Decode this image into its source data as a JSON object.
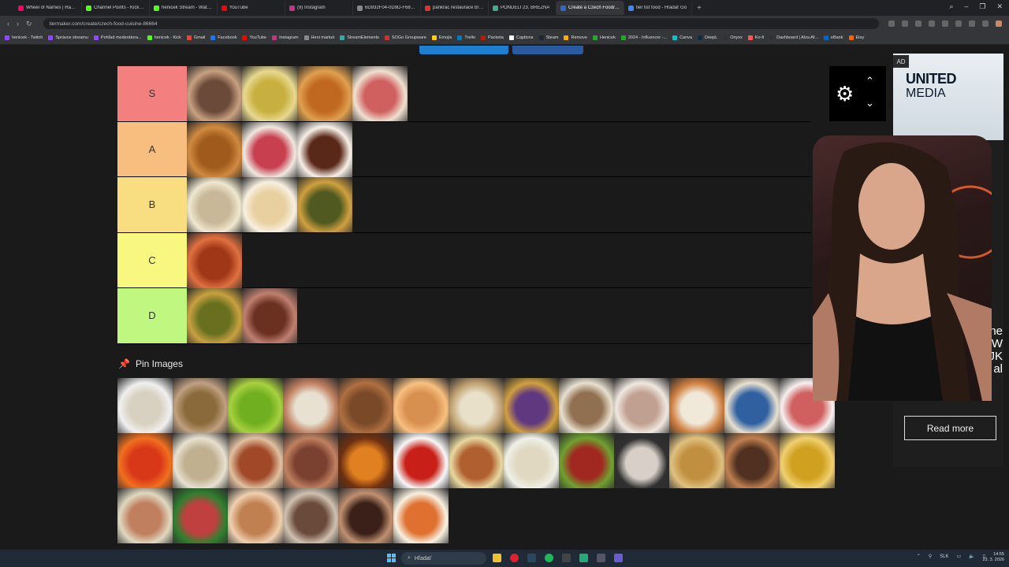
{
  "browser": {
    "tabs": [
      {
        "label": "Wheel of Names | Rando",
        "color": "#f06"
      },
      {
        "label": "Channel Points - Kick Das",
        "color": "#53fc18"
      },
      {
        "label": "henicek Stream - Watch L",
        "color": "#53fc18"
      },
      {
        "label": "YouTube",
        "color": "#f00"
      },
      {
        "label": "(9) Instagram",
        "color": "#c13584"
      },
      {
        "label": "6D932F04-0D9D-F686-2!",
        "color": "#888"
      },
      {
        "label": "pankrác restaurace brami",
        "color": "#d33"
      },
      {
        "label": "PONDĚLÍ 23. BŘEZNA",
        "color": "#4a8"
      },
      {
        "label": "Create a Czech Food/Cu",
        "color": "#36c",
        "active": true
      },
      {
        "label": "tier list food - Hľadať Go",
        "color": "#4285f4"
      }
    ],
    "new_tab": "+",
    "url": "tiermaker.com/create/czech-food-cuisine-86664",
    "bookmarks": [
      {
        "label": "henicek - Twitch",
        "color": "#9146ff"
      },
      {
        "label": "Správce streamu",
        "color": "#9146ff"
      },
      {
        "label": "Pohľad moderátora...",
        "color": "#9146ff"
      },
      {
        "label": "henicek - Kick",
        "color": "#53fc18"
      },
      {
        "label": "Gmail",
        "color": "#ea4335"
      },
      {
        "label": "Facebook",
        "color": "#1877f2"
      },
      {
        "label": "YouTube",
        "color": "#f00"
      },
      {
        "label": "Instagram",
        "color": "#c13584"
      },
      {
        "label": "Heni market",
        "color": "#888"
      },
      {
        "label": "StreamElements",
        "color": "#3aa"
      },
      {
        "label": "SOGo Groupware",
        "color": "#c33"
      },
      {
        "label": "Emojis",
        "color": "#fc0"
      },
      {
        "label": "Trello",
        "color": "#0079bf"
      },
      {
        "label": "Packeta",
        "color": "#ba1b02"
      },
      {
        "label": "Captions",
        "color": "#fff"
      },
      {
        "label": "Steam",
        "color": "#1b2838"
      },
      {
        "label": "Remove",
        "color": "#fa0"
      },
      {
        "label": "Henicek",
        "color": "#2a2"
      },
      {
        "label": "2024 - Influencer -...",
        "color": "#2a2"
      },
      {
        "label": "Canva",
        "color": "#00c4cc"
      },
      {
        "label": "DeepL",
        "color": "#0f2b46"
      },
      {
        "label": "Onyxx",
        "color": "#333"
      },
      {
        "label": "Ko-fi",
        "color": "#f55"
      },
      {
        "label": "Dashboard | Alza Af...",
        "color": "#333"
      },
      {
        "label": "eBank",
        "color": "#06c"
      },
      {
        "label": "Etsy",
        "color": "#f56400"
      }
    ]
  },
  "tierlist": {
    "tiers": [
      {
        "label": "S",
        "color": "#f47f7f",
        "items": [
          [
            "#6b4a3a",
            "#c8a080"
          ],
          [
            "#c8b040",
            "#e8d890"
          ],
          [
            "#c06820",
            "#e0a050"
          ],
          [
            "#d06060",
            "#f0e0d0"
          ]
        ]
      },
      {
        "label": "A",
        "color": "#f8be80",
        "items": [
          [
            "#a05a1c",
            "#d08a40"
          ],
          [
            "#c84050",
            "#f0e8e0"
          ],
          [
            "#5a2818",
            "#f8f0e8"
          ]
        ]
      },
      {
        "label": "B",
        "color": "#f8de80",
        "items": [
          [
            "#c8b898",
            "#f0e8d0"
          ],
          [
            "#e8d0a0",
            "#f8f0e0"
          ],
          [
            "#505a20",
            "#d0a040"
          ]
        ]
      },
      {
        "label": "C",
        "color": "#f8f780",
        "items": [
          [
            "#a03818",
            "#e07040"
          ]
        ]
      },
      {
        "label": "D",
        "color": "#bff780",
        "items": [
          [
            "#687020",
            "#c8a040"
          ],
          [
            "#6a3020",
            "#c08070"
          ]
        ]
      }
    ],
    "settings_icon": "gear-icon"
  },
  "pin_images": {
    "heading": "Pin Images",
    "items": [
      [
        "#d8d0c0",
        "#f0f0f0"
      ],
      [
        "#8a6a3a",
        "#c0a080"
      ],
      [
        "#70b020",
        "#a8d040"
      ],
      [
        "#e8e0d0",
        "#c08060"
      ],
      [
        "#7a4a28",
        "#b07040"
      ],
      [
        "#d89050",
        "#f8c080"
      ],
      [
        "#e8e0c8",
        "#c0a070"
      ],
      [
        "#603880",
        "#d0a040"
      ],
      [
        "#907050",
        "#e8e0d0"
      ],
      [
        "#c0a090",
        "#f0e8e0"
      ],
      [
        "#f0e8d8",
        "#d08040"
      ],
      [
        "#3060a0",
        "#e8e0d0"
      ],
      [
        "#d06060",
        "#f8f0f0"
      ],
      [
        "#d83818",
        "#f07020"
      ],
      [
        "#c0b090",
        "#e8e0d0"
      ],
      [
        "#a04828",
        "#e0c0a0"
      ],
      [
        "#7a4030",
        "#c08060"
      ],
      [
        "#e08020",
        "#703010"
      ],
      [
        "#c82018",
        "#f8f8f8"
      ],
      [
        "#b06030",
        "#e8d8a0"
      ],
      [
        "#e0d8c0",
        "#f0f0e8"
      ],
      [
        "#a02820",
        "#70a030"
      ],
      [
        "#d8d0c8",
        "#303030"
      ],
      [
        "#c09040",
        "#e0c080"
      ],
      [
        "#503020",
        "#c08050"
      ],
      [
        "#d0a020",
        "#f0d070"
      ],
      [
        "#c08060",
        "#e0d8c0"
      ],
      [
        "#c04040",
        "#308030"
      ],
      [
        "#c08050",
        "#f0d0b0"
      ],
      [
        "#6a4a3a",
        "#d0c0b0"
      ],
      [
        "#3a2018",
        "#c09070"
      ],
      [
        "#e07030",
        "#f8f0e0"
      ]
    ]
  },
  "ad": {
    "tag": "AD",
    "brand_line1": "UNITED",
    "brand_line2": "MEDIA",
    "side_text": "ne\nW\nJK\nal",
    "cta": "Read more"
  },
  "taskbar": {
    "search_placeholder": "Hľadať",
    "lang": "SLK",
    "time": "14:55",
    "date": "23. 3. 2026"
  }
}
